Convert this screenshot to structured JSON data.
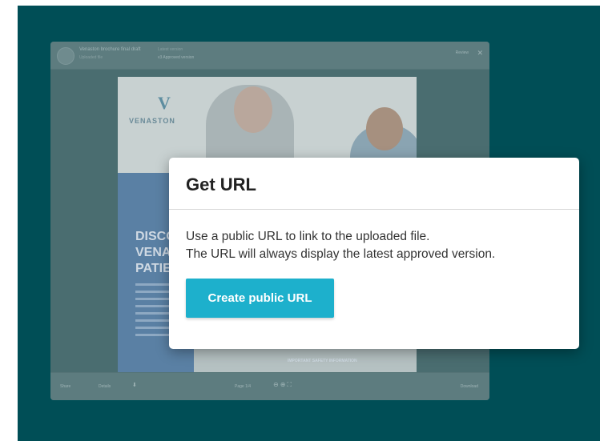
{
  "background": {
    "overlay_color": "#004e56",
    "viewer": {
      "title": "Venaston brochure final draft",
      "subtitle": "Uploaded file",
      "meta_label": "Latest version",
      "meta_value": "v3  Approved version",
      "review_label": "Review",
      "close_icon": "close-icon",
      "document": {
        "logo_letter": "V",
        "logo_text": "VENASTON",
        "headline": [
          "DISCO",
          "VENA",
          "PATIE"
        ],
        "footer_text": "IMPORTANT SAFETY INFORMATION"
      },
      "toolbar": {
        "left_1": "Share",
        "left_2": "Details",
        "page": "Page 1/4",
        "right": "Download"
      }
    }
  },
  "modal": {
    "title": "Get URL",
    "description_line1": "Use a public URL to link to the uploaded file.",
    "description_line2": "The URL will always display the latest approved version.",
    "button_label": "Create public URL",
    "button_color": "#1db0cc"
  }
}
